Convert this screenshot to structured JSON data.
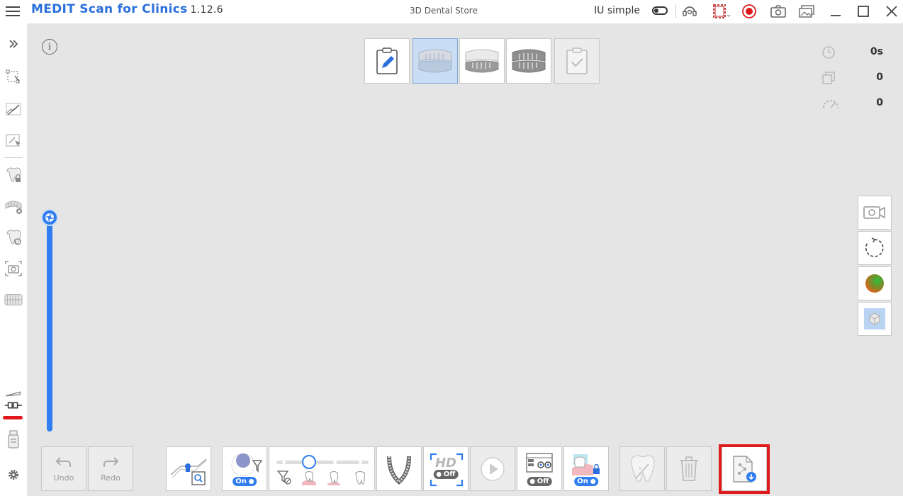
{
  "titlebar": {
    "app_name": "MEDIT Scan for Clinics",
    "version": "1.12.6",
    "store": "3D Dental Store",
    "mode_label": "IU simple"
  },
  "stats": {
    "time": "0s",
    "copies": "0",
    "speed": "0"
  },
  "toolbar": {
    "undo_label": "Undo",
    "redo_label": "Redo",
    "filter_state": "On",
    "hd_label": "HD",
    "hd_state": "Off",
    "ai_state": "Off",
    "lock_state": "On"
  },
  "info": {
    "label": "i"
  },
  "colors": {
    "brand": "#2a6fdb",
    "accent": "#2f7df0",
    "record": "#e0191b",
    "highlight": "#e0191b"
  }
}
